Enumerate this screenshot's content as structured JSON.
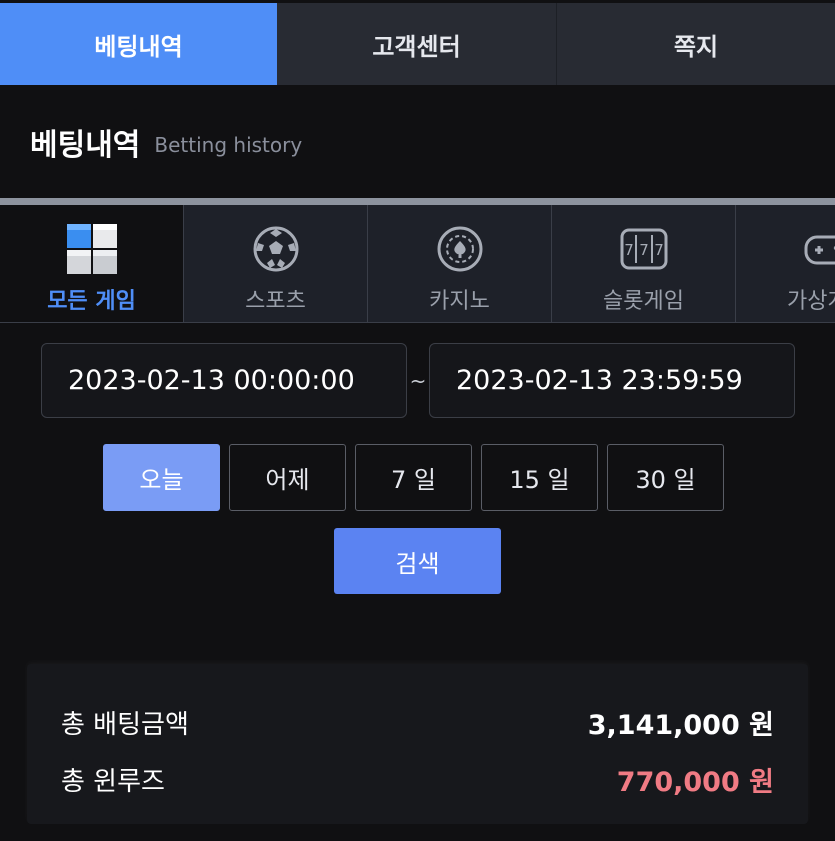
{
  "topnav": {
    "tabs": [
      {
        "label": "베팅내역",
        "active": true
      },
      {
        "label": "고객센터",
        "active": false
      },
      {
        "label": "쪽지",
        "active": false
      }
    ]
  },
  "header": {
    "title": "베팅내역",
    "subtitle": "Betting history"
  },
  "game_tabs": [
    {
      "label": "모든 게임",
      "icon": "cubes-icon",
      "active": true
    },
    {
      "label": "스포츠",
      "icon": "soccer-ball-icon",
      "active": false
    },
    {
      "label": "카지노",
      "icon": "casino-chip-icon",
      "active": false
    },
    {
      "label": "슬롯게임",
      "icon": "slot-machine-icon",
      "active": false
    },
    {
      "label": "가상게임",
      "icon": "gamepad-icon",
      "active": false
    }
  ],
  "date_range": {
    "start": "2023-02-13 00:00:00",
    "separator": "~",
    "end": "2023-02-13 23:59:59"
  },
  "quick_range": [
    {
      "label": "오늘",
      "active": true
    },
    {
      "label": "어제",
      "active": false
    },
    {
      "label": "7 일",
      "active": false
    },
    {
      "label": "15 일",
      "active": false
    },
    {
      "label": "30 일",
      "active": false
    }
  ],
  "search_label": "검색",
  "summary": {
    "total_bet_label": "총 배팅금액",
    "total_bet_value": "3,141,000 원",
    "total_winloss_label": "총 윈루즈",
    "total_winloss_value": "770,000 원"
  },
  "colors": {
    "accent": "#4f8ef7",
    "search_button": "#5b83f2",
    "quick_active": "#7a9cf5",
    "loss_red": "#f07b84",
    "background": "#101012"
  }
}
